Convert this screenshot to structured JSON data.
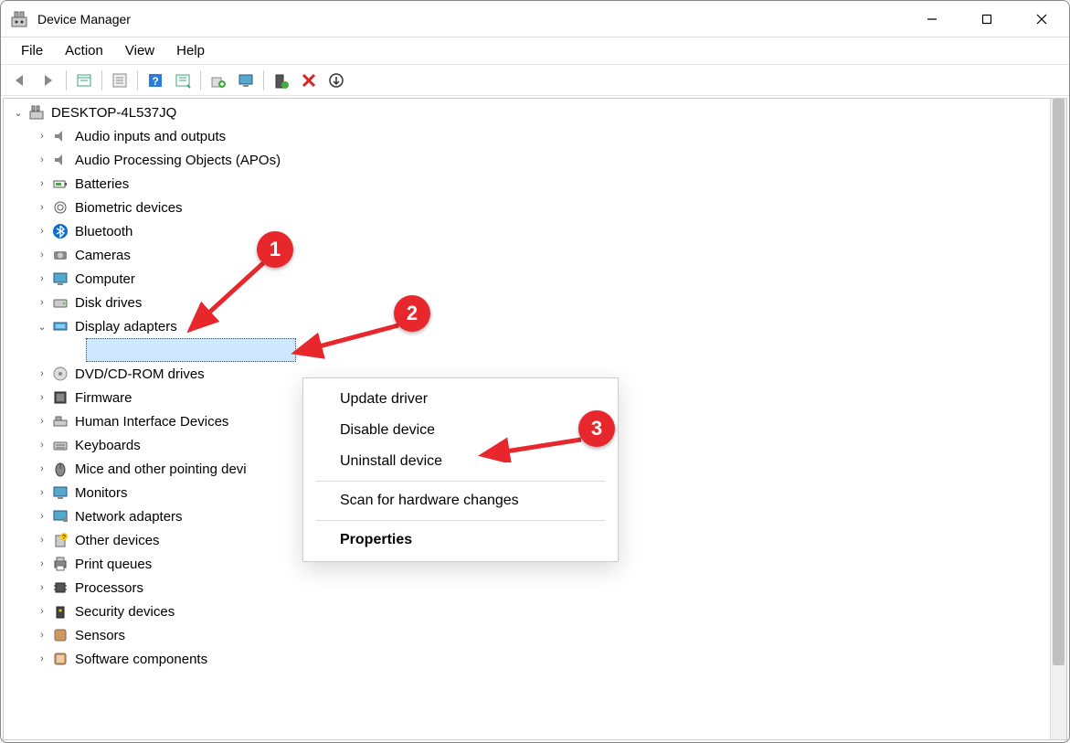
{
  "window": {
    "title": "Device Manager"
  },
  "menubar": [
    "File",
    "Action",
    "View",
    "Help"
  ],
  "tree": {
    "root": "DESKTOP-4L537JQ",
    "items": [
      "Audio inputs and outputs",
      "Audio Processing Objects (APOs)",
      "Batteries",
      "Biometric devices",
      "Bluetooth",
      "Cameras",
      "Computer",
      "Disk drives",
      "Display adapters",
      "DVD/CD-ROM drives",
      "Firmware",
      "Human Interface Devices",
      "Keyboards",
      "Mice and other pointing devi",
      "Monitors",
      "Network adapters",
      "Other devices",
      "Print queues",
      "Processors",
      "Security devices",
      "Sensors",
      "Software components"
    ],
    "expanded_index": 8
  },
  "context_menu": {
    "items": [
      "Update driver",
      "Disable device",
      "Uninstall device",
      "Scan for hardware changes",
      "Properties"
    ]
  },
  "callouts": {
    "c1": "1",
    "c2": "2",
    "c3": "3"
  }
}
